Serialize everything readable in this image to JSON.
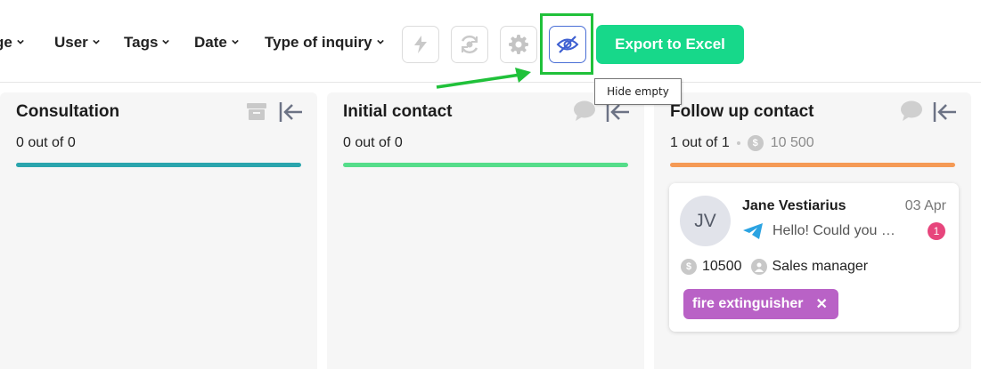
{
  "toolbar": {
    "filters": [
      "ge",
      "User",
      "Tags",
      "Date",
      "Type of inquiry"
    ],
    "icons": {
      "automation": "lightning-icon",
      "sync": "sync-icon",
      "settings": "gear-icon",
      "hide_empty": "eye-slash-icon"
    },
    "export_label": "Export to Excel",
    "tooltip": "Hide empty"
  },
  "columns": [
    {
      "title": "Consultation",
      "count": "0 out of 0",
      "color": "#2aa5ad",
      "icon": "archive-icon"
    },
    {
      "title": "Initial contact",
      "count": "0 out of 0",
      "color": "#55dd8a",
      "icon": "chat-bubble-icon"
    },
    {
      "title": "Follow up contact",
      "count": "1 out of 1",
      "amount": "10 500",
      "color": "#f59a55",
      "icon": "chat-bubble-icon"
    }
  ],
  "card": {
    "initials": "JV",
    "name": "Jane Vestiarius",
    "date": "03 Apr",
    "message": "Hello! Could you …",
    "unread": "1",
    "amount": "10500",
    "role": "Sales manager",
    "tag": "fire extinguisher",
    "tag_color": "#b962c6"
  },
  "colors": {
    "accent": "#17d88a",
    "highlight": "#20c13a",
    "active_icon": "#3d5fd1"
  }
}
